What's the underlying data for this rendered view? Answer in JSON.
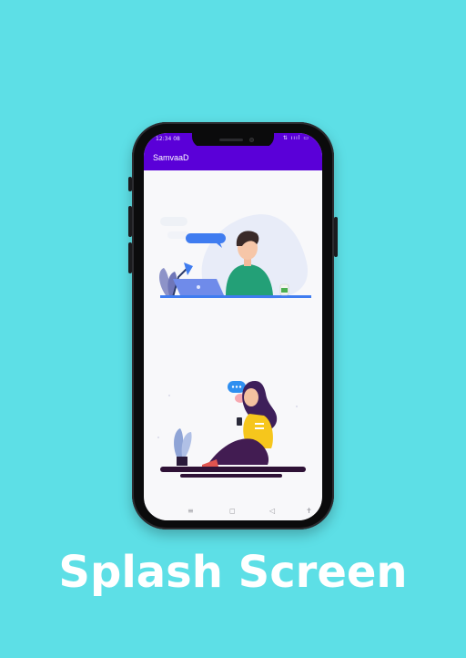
{
  "status_bar": {
    "time": "12:34 08",
    "icons": "⇅ ıııl ▭"
  },
  "app_bar": {
    "title": "SamvaaD"
  },
  "nav_bar": {
    "menu_icon": "≡",
    "home_icon": "◻",
    "back_icon": "◁",
    "accessibility_icon": "✝"
  },
  "caption": {
    "text": "Splash Screen"
  },
  "colors": {
    "background": "#5ddfe6",
    "app_bar": "#5a00d8",
    "screen": "#f8f8fa",
    "phone_body": "#0b0b0c"
  }
}
